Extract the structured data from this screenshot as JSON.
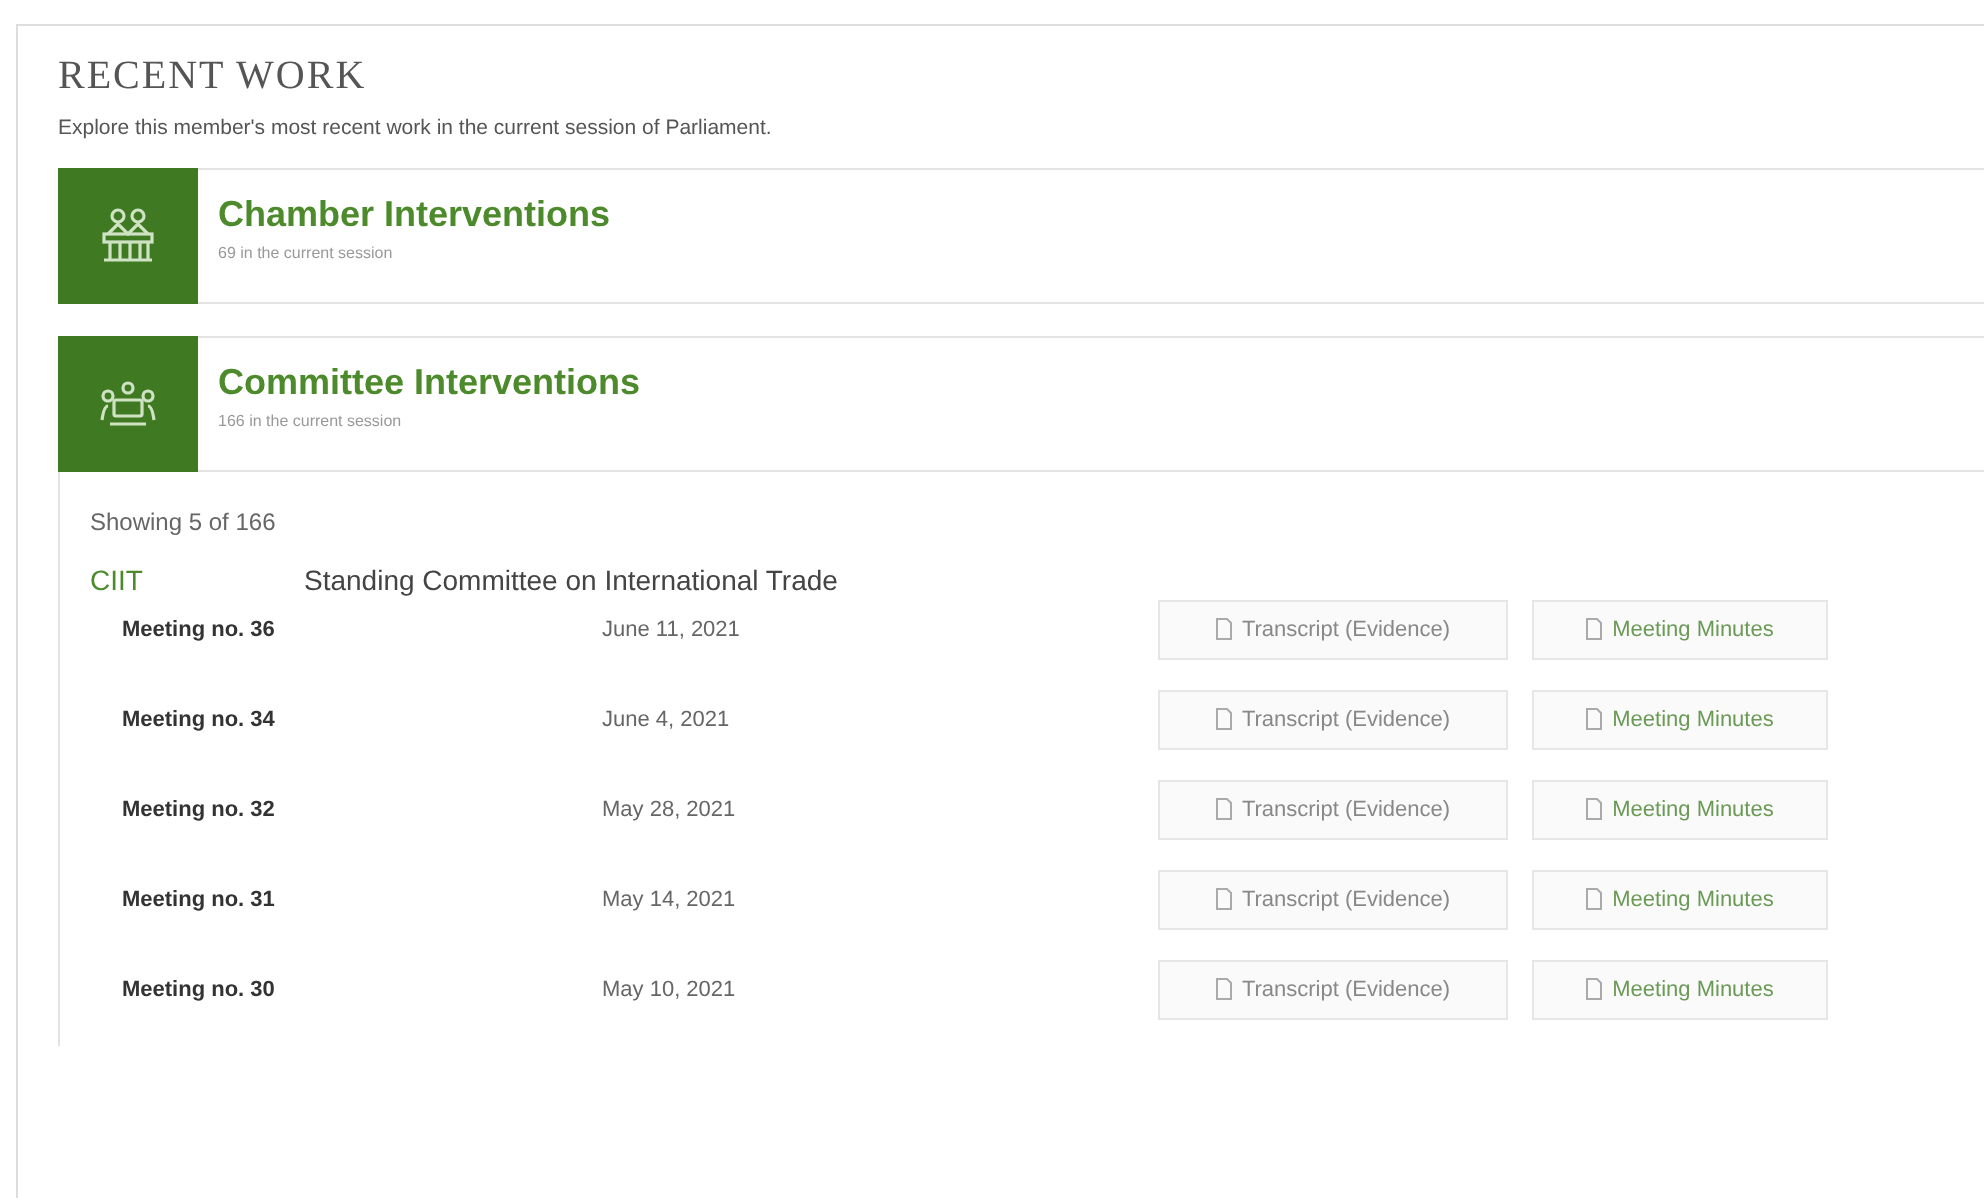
{
  "heading": "RECENT WORK",
  "intro": "Explore this member's most recent work in the current session of Parliament.",
  "sections": [
    {
      "kind": "chamber",
      "title": "Chamber Interventions",
      "subtitle": "69 in the current session",
      "expanded": false
    },
    {
      "kind": "committee",
      "title": "Committee Interventions",
      "subtitle": "166 in the current session",
      "expanded": true,
      "showing": "Showing 5 of 166",
      "committee": {
        "code": "CIIT",
        "name": "Standing Committee on International Trade"
      },
      "meetings": [
        {
          "meeting": "Meeting no. 36",
          "date": "June 11, 2021",
          "links": [
            "Transcript (Evidence)",
            "Meeting Minutes"
          ]
        },
        {
          "meeting": "Meeting no. 34",
          "date": "June 4, 2021",
          "links": [
            "Transcript (Evidence)",
            "Meeting Minutes"
          ]
        },
        {
          "meeting": "Meeting no. 32",
          "date": "May 28, 2021",
          "links": [
            "Transcript (Evidence)",
            "Meeting Minutes"
          ]
        },
        {
          "meeting": "Meeting no. 31",
          "date": "May 14, 2021",
          "links": [
            "Transcript (Evidence)",
            "Meeting Minutes"
          ]
        },
        {
          "meeting": "Meeting no. 30",
          "date": "May 10, 2021",
          "links": [
            "Transcript (Evidence)",
            "Meeting Minutes"
          ]
        }
      ]
    }
  ]
}
